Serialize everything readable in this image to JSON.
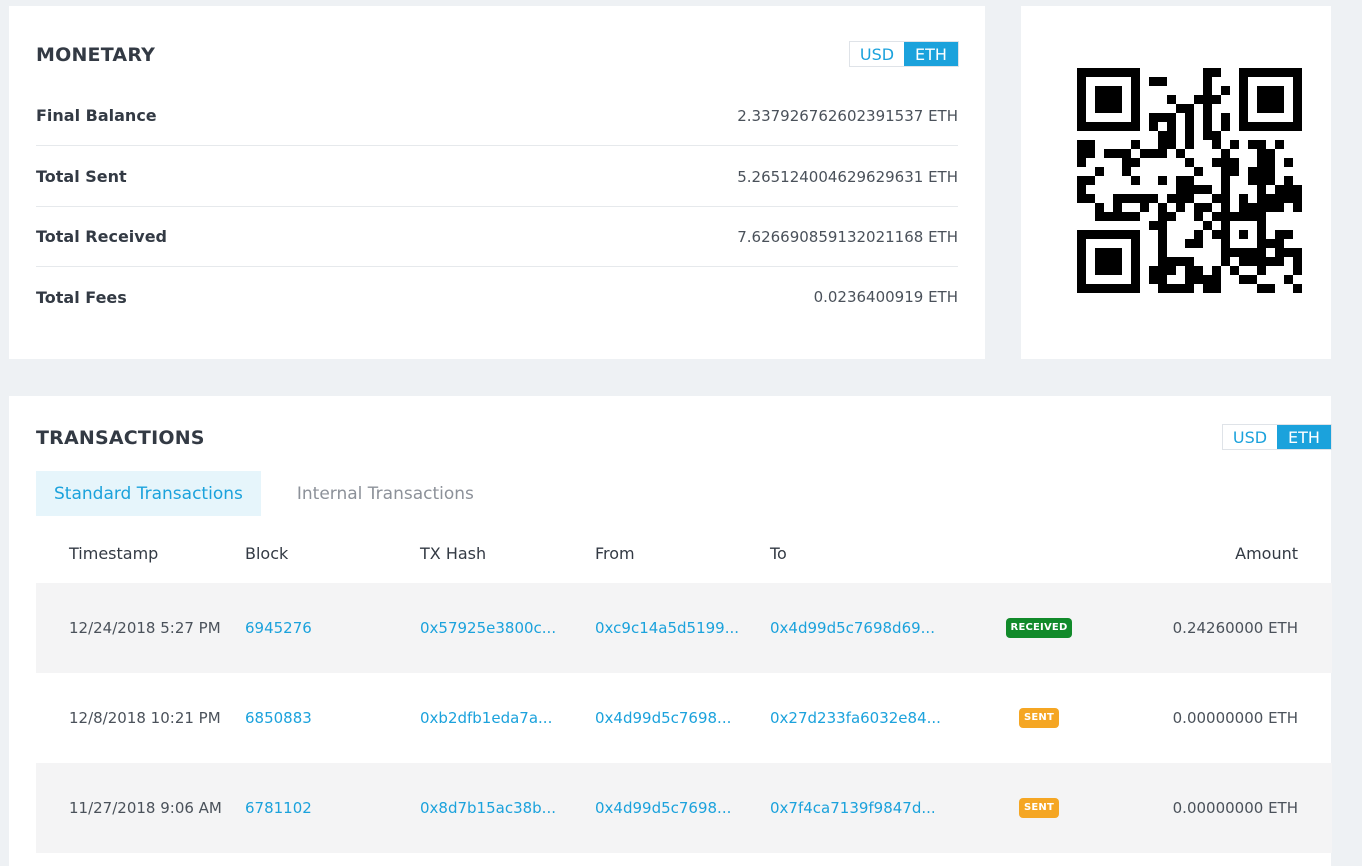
{
  "monetary": {
    "title": "MONETARY",
    "currency_toggle": {
      "usd": "USD",
      "eth": "ETH",
      "active": "ETH"
    },
    "rows": [
      {
        "label": "Final Balance",
        "value": "2.337926762602391537 ETH"
      },
      {
        "label": "Total Sent",
        "value": "5.265124004629629631 ETH"
      },
      {
        "label": "Total Received",
        "value": "7.626690859132021168 ETH"
      },
      {
        "label": "Total Fees",
        "value": "0.0236400919 ETH"
      }
    ]
  },
  "qr": {
    "icon": "qr-code-icon"
  },
  "transactions": {
    "title": "TRANSACTIONS",
    "currency_toggle": {
      "usd": "USD",
      "eth": "ETH",
      "active": "ETH"
    },
    "tabs": [
      {
        "label": "Standard Transactions",
        "active": true
      },
      {
        "label": "Internal Transactions",
        "active": false
      }
    ],
    "columns": {
      "timestamp": "Timestamp",
      "block": "Block",
      "tx_hash": "TX Hash",
      "from": "From",
      "to": "To",
      "amount": "Amount"
    },
    "rows": [
      {
        "timestamp": "12/24/2018 5:27 PM",
        "block": "6945276",
        "tx_hash": "0x57925e3800c...",
        "from": "0xc9c14a5d5199...",
        "to": "0x4d99d5c7698d69...",
        "direction": "RECEIVED",
        "amount": "0.24260000 ETH"
      },
      {
        "timestamp": "12/8/2018 10:21 PM",
        "block": "6850883",
        "tx_hash": "0xb2dfb1eda7a...",
        "from": "0x4d99d5c7698...",
        "to": "0x27d233fa6032e84...",
        "direction": "SENT",
        "amount": "0.00000000 ETH"
      },
      {
        "timestamp": "11/27/2018 9:06 AM",
        "block": "6781102",
        "tx_hash": "0x8d7b15ac38b...",
        "from": "0x4d99d5c7698...",
        "to": "0x7f4ca7139f9847d...",
        "direction": "SENT",
        "amount": "0.00000000 ETH"
      }
    ]
  },
  "colors": {
    "accent": "#1ba2dc",
    "received": "#118a2a",
    "sent": "#f5a623",
    "background": "#eef1f4"
  }
}
